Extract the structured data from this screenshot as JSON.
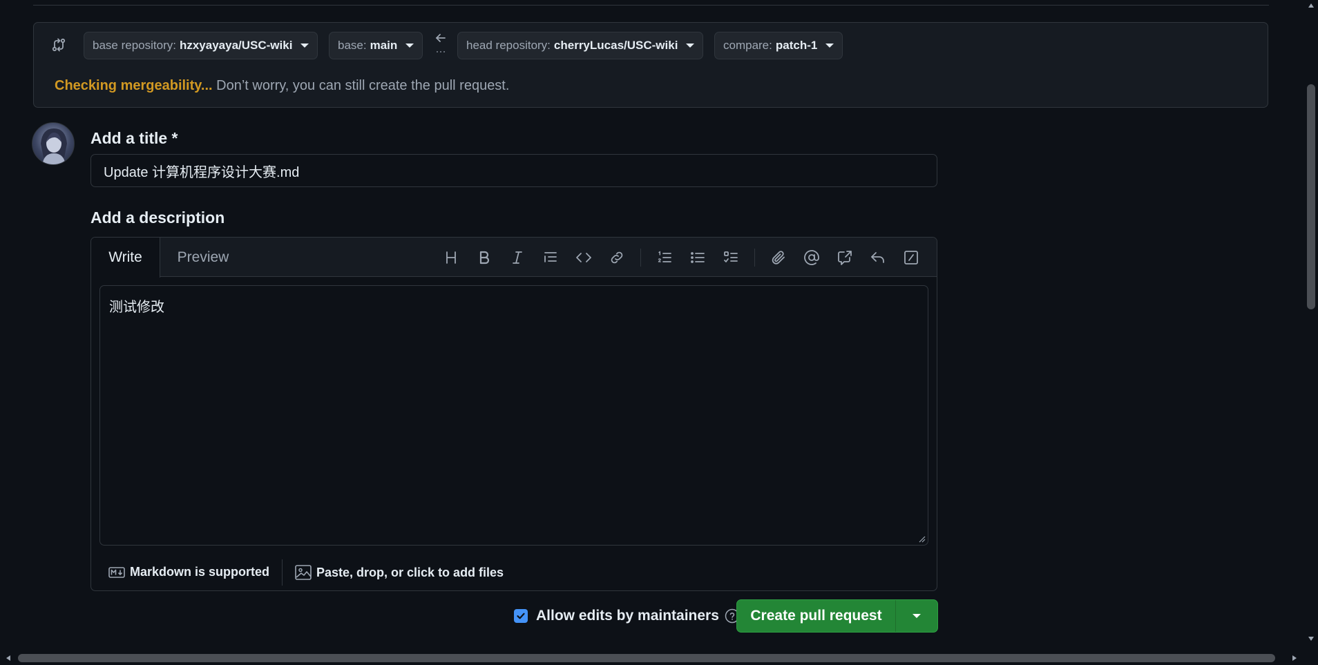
{
  "compare": {
    "base_repo_key": "base repository:",
    "base_repo_value": "hzxyayaya/USC-wiki",
    "base_key": "base:",
    "base_value": "main",
    "head_repo_key": "head repository:",
    "head_repo_value": "cherryLucas/USC-wiki",
    "compare_key": "compare:",
    "compare_value": "patch-1",
    "status_warning": "Checking mergeability...",
    "status_message": "Don’t worry, you can still create the pull request.",
    "warning_color": "#d29922"
  },
  "form": {
    "title_label": "Add a title *",
    "title_value": "Update 计算机程序设计大赛.md",
    "description_label": "Add a description",
    "tabs": [
      "Write",
      "Preview"
    ],
    "active_tab": "Write",
    "description_value": "测试修改",
    "toolbar_icons": [
      "heading-icon",
      "bold-icon",
      "italic-icon",
      "quote-icon",
      "code-icon",
      "link-icon",
      "ordered-list-icon",
      "unordered-list-icon",
      "task-list-icon",
      "attach-icon",
      "mention-icon",
      "cross-reference-icon",
      "saved-reply-icon",
      "slash-command-icon"
    ],
    "markdown_hint": "Markdown is supported",
    "attach_hint": "Paste, drop, or click to add files"
  },
  "actions": {
    "allow_edits_label": "Allow edits by maintainers",
    "allow_edits_checked": true,
    "create_label": "Create pull request",
    "primary_color": "#238636"
  }
}
